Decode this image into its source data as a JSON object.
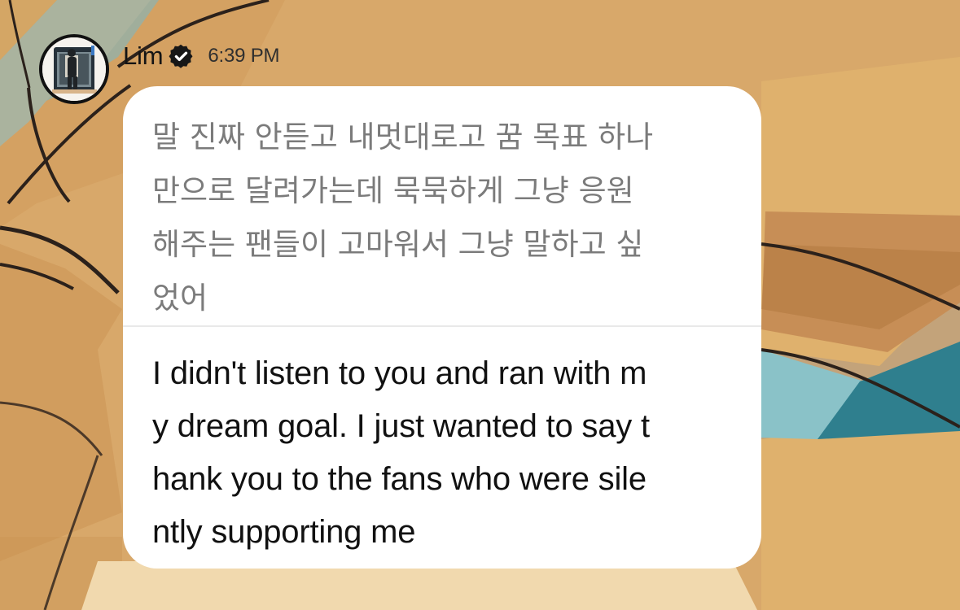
{
  "background": {
    "description_colors": {
      "tan": "#d8a86a",
      "orange": "#c99150",
      "blue": "#78bfd2",
      "cream": "#f1d9ae",
      "outline": "#2b211b"
    }
  },
  "post": {
    "author": "Lim",
    "verified_icon": "verified-badge-icon",
    "time": "6:39 PM",
    "message_korean": "말 진짜 안듣고  내멋대로고  꿈 목표 하나\n만으로 달려가는데  묵묵하게  그냥  응원\n해주는 팬들이 고마워서  그냥  말하고 싶\n었어",
    "message_english": "I didn't listen to you and ran with m\ny dream goal. I just wanted to say t\nhank you to the fans who were sile\nntly supporting me"
  }
}
